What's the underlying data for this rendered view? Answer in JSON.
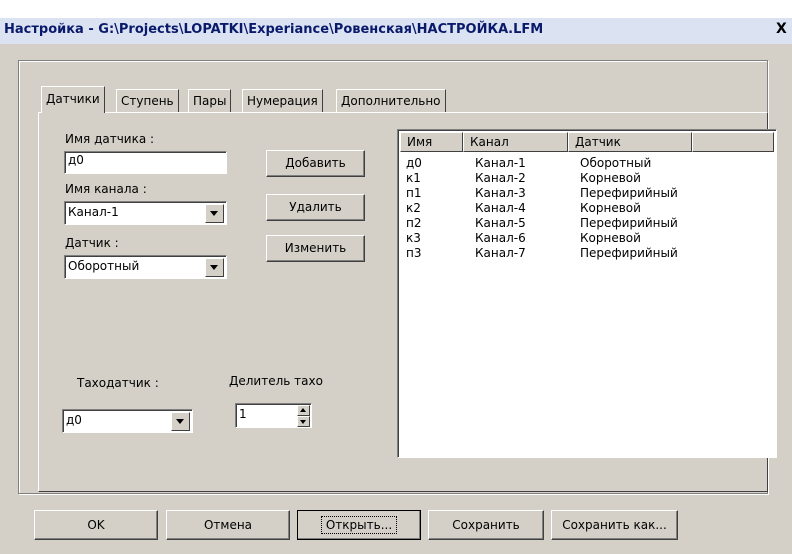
{
  "window": {
    "title": "Настройка - G:\\Projects\\LOPATKI\\Experiance\\Ровенская\\НАСТРОЙКА.LFM",
    "close_glyph": "X"
  },
  "tabs": [
    {
      "label": "Датчики",
      "active": true
    },
    {
      "label": "Ступень",
      "active": false
    },
    {
      "label": "Пары",
      "active": false
    },
    {
      "label": "Нумерация",
      "active": false
    },
    {
      "label": "Дополнительно",
      "active": false
    }
  ],
  "sensors_tab": {
    "sensor_name_label": "Имя датчика :",
    "sensor_name_value": "д0",
    "channel_name_label": "Имя канала :",
    "channel_value": "Канал-1",
    "sensor_type_label": "Датчик :",
    "sensor_type_value": "Оборотный",
    "add_button": "Добавить",
    "delete_button": "Удалить",
    "change_button": "Изменить",
    "tacho_label": "Таходатчик :",
    "tacho_value": "д0",
    "tacho_divider_label": "Делитель тахо",
    "tacho_divider_value": "1"
  },
  "sensor_list": {
    "columns": [
      "Имя",
      "Канал",
      "Датчик"
    ],
    "rows": [
      [
        "д0",
        "Канал-1",
        "Оборотный"
      ],
      [
        "к1",
        "Канал-2",
        "Корневой"
      ],
      [
        "п1",
        "Канал-3",
        "Перефирийный"
      ],
      [
        "к2",
        "Канал-4",
        "Корневой"
      ],
      [
        "п2",
        "Канал-5",
        "Перефирийный"
      ],
      [
        "к3",
        "Канал-6",
        "Корневой"
      ],
      [
        "п3",
        "Канал-7",
        "Перефирийный"
      ]
    ]
  },
  "footer": {
    "ok_button": "OK",
    "cancel_button": "Отмена",
    "open_button": "Открыть...",
    "save_button": "Сохранить",
    "save_as_button": "Сохранить как..."
  },
  "colors": {
    "titlebar_bg": "#dbe3f3",
    "title_text": "#0a1a6b",
    "window_bg": "#d4d0c8"
  }
}
